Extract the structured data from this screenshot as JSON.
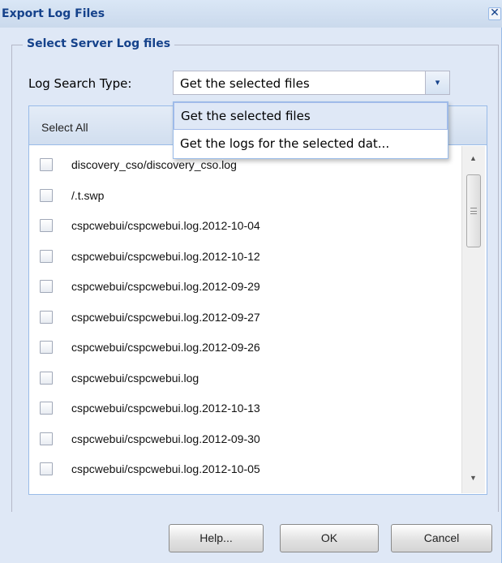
{
  "dialog": {
    "title": "Export Log Files",
    "close_glyph": "✕"
  },
  "fieldset": {
    "legend": "Select Server Log files"
  },
  "search_type": {
    "label": "Log Search Type:",
    "value": "Get the selected files",
    "trigger_glyph": "▾"
  },
  "dropdown": {
    "options": [
      "Get the selected files",
      "Get the logs for the selected dat..."
    ]
  },
  "grid": {
    "header": "Select All",
    "rows": [
      "discovery_cso/discovery_cso.log",
      "/.t.swp",
      "cspcwebui/cspcwebui.log.2012-10-04",
      "cspcwebui/cspcwebui.log.2012-10-12",
      "cspcwebui/cspcwebui.log.2012-09-29",
      "cspcwebui/cspcwebui.log.2012-09-27",
      "cspcwebui/cspcwebui.log.2012-09-26",
      "cspcwebui/cspcwebui.log",
      "cspcwebui/cspcwebui.log.2012-10-13",
      "cspcwebui/cspcwebui.log.2012-09-30",
      "cspcwebui/cspcwebui.log.2012-10-05"
    ]
  },
  "scrollbar": {
    "up_glyph": "▲",
    "down_glyph": "▼"
  },
  "buttons": {
    "help": "Help...",
    "ok": "OK",
    "cancel": "Cancel"
  }
}
